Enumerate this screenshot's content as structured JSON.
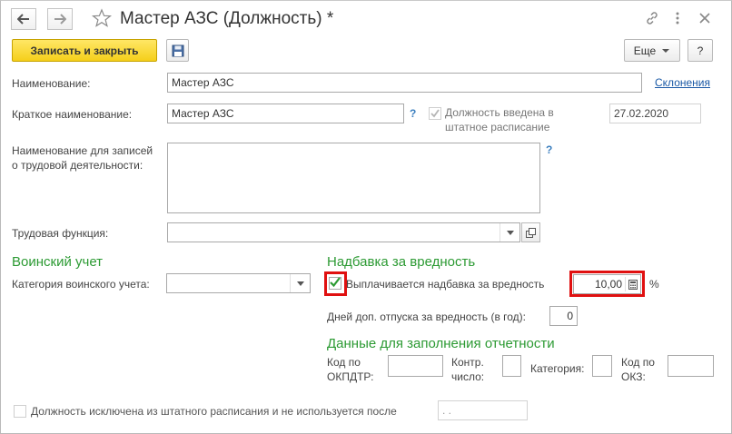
{
  "window": {
    "title": "Мастер АЗС (Должность) *"
  },
  "toolbar": {
    "save_close_label": "Записать и закрыть",
    "more_label": "Еще",
    "help_label": "?"
  },
  "form": {
    "name_label": "Наименование:",
    "name_value": "Мастер АЗС",
    "declensions_link": "Склонения",
    "short_name_label": "Краткое наименование:",
    "short_name_value": "Мастер АЗС",
    "short_name_hint": "?",
    "in_staff_label_1": "Должность введена в",
    "in_staff_label_2": "штатное расписание",
    "in_staff_checked": true,
    "in_staff_date": "27.02.2020",
    "work_record_label_1": "Наименование для записей",
    "work_record_label_2": "о трудовой деятельности:",
    "work_record_value": "",
    "work_record_hint": "?",
    "labor_function_label": "Трудовая функция:",
    "labor_function_value": ""
  },
  "military": {
    "section_title": "Воинский учет",
    "category_label": "Категория воинского учета:",
    "category_value": ""
  },
  "hazard": {
    "section_title": "Надбавка за вредность",
    "allowance_label": "Выплачивается надбавка за вредность",
    "allowance_checked": true,
    "allowance_value": "10,00",
    "percent_sign": "%",
    "extra_leave_label": "Дней доп. отпуска за вредность (в год):",
    "extra_leave_value": "0"
  },
  "reporting": {
    "section_title": "Данные для заполнения отчетности",
    "okpdtr_label_1": "Код по",
    "okpdtr_label_2": "ОКПДТР:",
    "okpdtr_value": "",
    "check_number_label_1": "Контр.",
    "check_number_label_2": "число:",
    "check_number_value": "",
    "category_label": "Категория:",
    "category_value": "",
    "okz_label_1": "Код по",
    "okz_label_2": "ОКЗ:",
    "okz_value": ""
  },
  "excluded": {
    "label": "Должность исключена из штатного расписания и не используется после",
    "checked": false,
    "date_value": " .  ."
  },
  "colors": {
    "accent_section": "#2c9a33",
    "primary_button": "#f5cf1a",
    "highlight_box": "#e01010",
    "link": "#1a59a6"
  }
}
